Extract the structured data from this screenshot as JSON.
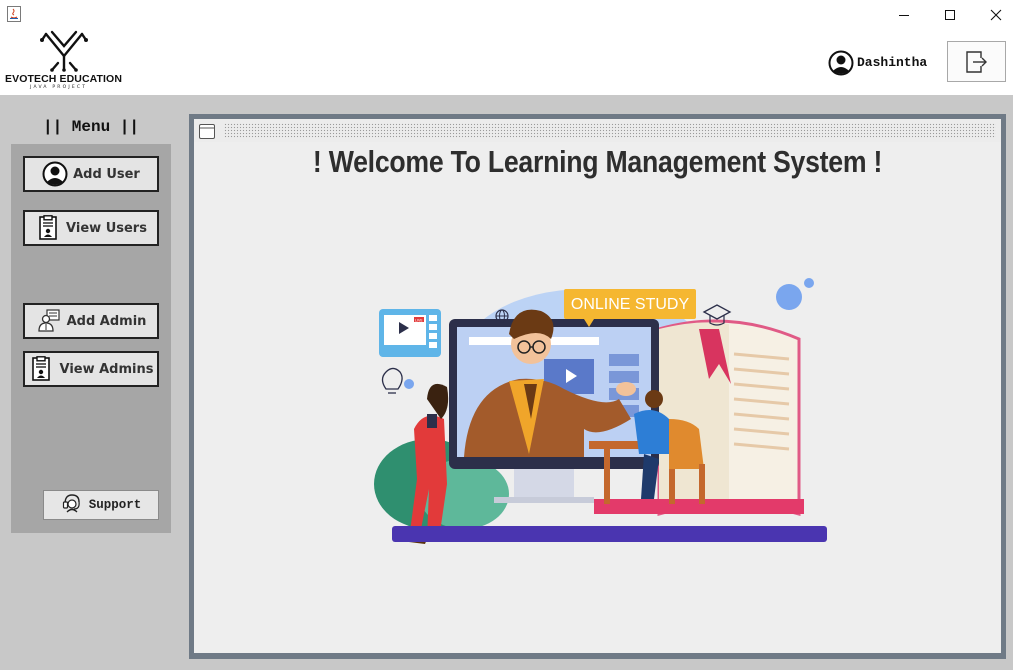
{
  "window": {
    "app_icon": "java-icon",
    "controls": [
      "minimize-icon",
      "maximize-icon",
      "close-icon"
    ]
  },
  "header": {
    "logo_title": "EVOTECH EDUCATION",
    "logo_subtitle": "JAVA PROJECT",
    "user_name": "Dashintha",
    "logout_icon": "logout-icon"
  },
  "menu": {
    "title": "|| Menu ||",
    "items": [
      {
        "label": "Add User",
        "icon": "user-circle-icon"
      },
      {
        "label": "View Users",
        "icon": "user-card-icon"
      },
      {
        "label": "Add Admin",
        "icon": "admin-icon"
      },
      {
        "label": "View Admins",
        "icon": "admin-card-icon"
      }
    ],
    "support": {
      "label": "Support",
      "icon": "headset-icon"
    }
  },
  "main": {
    "welcome": "! Welcome To Learning Management System !",
    "illustration": {
      "banner": "ONLINE STUDY",
      "live_badge": "LIVE"
    }
  },
  "colors": {
    "workarea": "#c8c8c8",
    "menu_panel": "#a6a6a6",
    "frame_border": "#6f7a86",
    "content_bg": "#eeeeee",
    "banner": "#f5b731",
    "floor": "#4a35b0"
  }
}
